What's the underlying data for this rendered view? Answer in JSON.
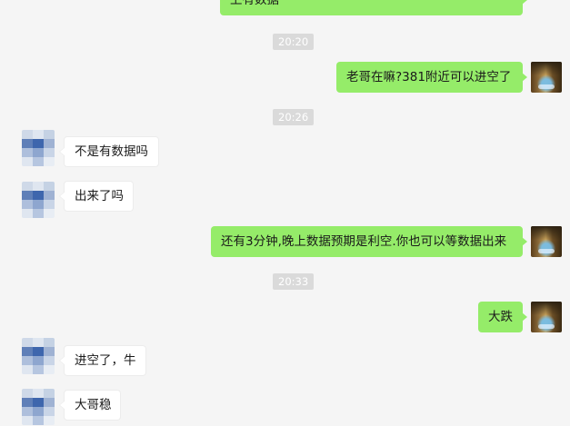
{
  "conversation": {
    "messages": [
      {
        "type": "outgoing",
        "text": "上有数据"
      },
      {
        "type": "time",
        "text": "20:20"
      },
      {
        "type": "outgoing",
        "text": "老哥在嘛?381附近可以进空了"
      },
      {
        "type": "time",
        "text": "20:26"
      },
      {
        "type": "incoming",
        "text": "不是有数据吗"
      },
      {
        "type": "incoming",
        "text": "出来了吗"
      },
      {
        "type": "outgoing",
        "text": "还有3分钟,晚上数据预期是利空.你也可以等数据出来"
      },
      {
        "type": "time",
        "text": "20:33"
      },
      {
        "type": "outgoing",
        "text": "大跌"
      },
      {
        "type": "incoming",
        "text": "进空了，牛"
      },
      {
        "type": "incoming",
        "text": "大哥稳"
      }
    ]
  },
  "colors": {
    "background": "#f5f5f5",
    "outgoing_bubble": "#95ec69",
    "incoming_bubble": "#ffffff",
    "timestamp_bg": "#dadada"
  },
  "icons": {
    "my_avatar": "landscape-photo-avatar",
    "contact_avatar": "pixelated-avatar"
  }
}
